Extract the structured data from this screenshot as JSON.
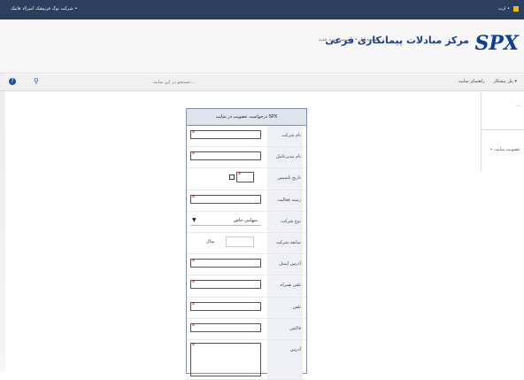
{
  "topbar": {
    "left_text": "شرکت توک فرنیشک امیرلاد فانیک •",
    "right_text": "ارت • "
  },
  "header": {
    "logo": "SPX",
    "title": "مرکز مبادلات پیمانکاری فرعی",
    "breadcrumb": "صفحه اول • عضویت مورد جدید"
  },
  "navbar": {
    "search_placeholder": "جستجو در این سایت...",
    "items": [
      "پنل پیشکار ▾",
      "راهنمای سایت"
    ]
  },
  "sidepanel": {
    "item1": "...",
    "item2": "• عضویت سایت"
  },
  "form": {
    "title": "درخواست عضویت در سایت SPX",
    "fields": [
      {
        "label": "نام شرکت"
      },
      {
        "label": "نام مدیرعامل"
      },
      {
        "label": "تاریخ تاسیس"
      },
      {
        "label": "زمینه فعالیت"
      },
      {
        "label": "نوع شرکت",
        "value": "سهامی خاص"
      },
      {
        "label": "سابقه شرکت",
        "unit": "سال"
      },
      {
        "label": "آدرس ایمیل"
      },
      {
        "label": "تلفن همراه"
      },
      {
        "label": "تلفن"
      },
      {
        "label": "فاکس"
      },
      {
        "label": "آدرس"
      }
    ]
  },
  "colors": {
    "topbar": "#2c3f5e",
    "logo": "#0b3c9a",
    "required": "#dd0000"
  }
}
